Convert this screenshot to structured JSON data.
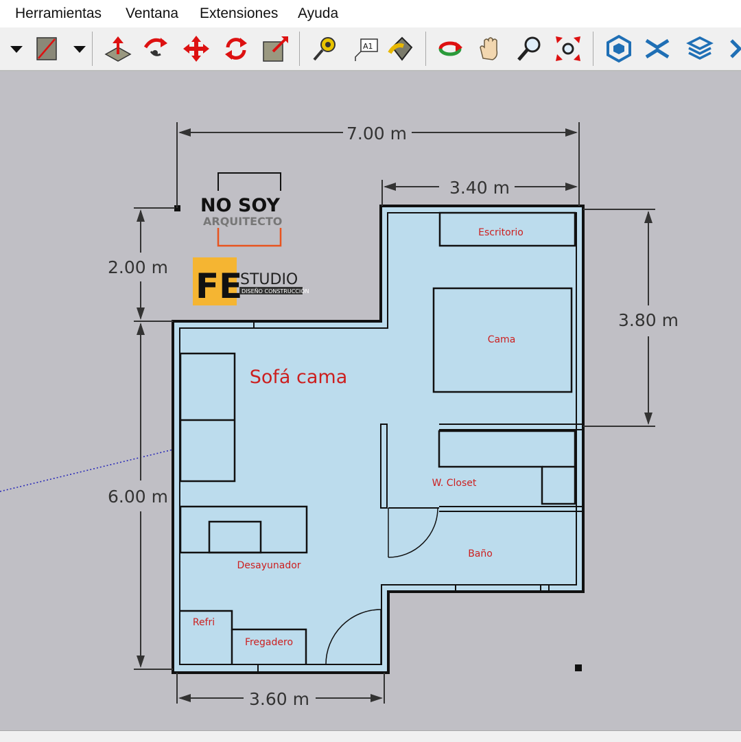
{
  "menu": {
    "items": [
      "Herramientas",
      "Ventana",
      "Extensiones",
      "Ayuda"
    ]
  },
  "toolbar": {
    "tools": [
      "dropdown-arrow-icon",
      "line-tool-icon",
      "dropdown-arrow-icon",
      "push-pull-icon",
      "follow-me-icon",
      "move-icon",
      "rotate-icon",
      "scale-icon",
      "tape-measure-icon",
      "text-label-icon",
      "paint-bucket-icon",
      "orbit-icon",
      "pan-icon",
      "zoom-icon",
      "zoom-extents-icon",
      "warehouse-icon",
      "extension-warehouse-icon",
      "layers-icon"
    ]
  },
  "floorplan": {
    "dimensions": {
      "total_width": "7.00 m",
      "upper_width": "3.40 m",
      "upper_height": "3.80 m",
      "offset_height": "2.00 m",
      "lower_height": "6.00 m",
      "lower_width": "3.60 m"
    },
    "rooms": {
      "sofa": "Sofá cama",
      "desk": "Escritorio",
      "bed": "Cama",
      "closet": "W. Closet",
      "bath": "Baño",
      "breakfast": "Desayunador",
      "fridge": "Refri",
      "sink": "Fregadero"
    },
    "colors": {
      "floor": "#bcdced",
      "wall": "#111111",
      "label": "#cc1f1f",
      "dimension": "#333333",
      "axis": "#2a2ab8"
    }
  },
  "logos": {
    "nosoy_line1": "NO SOY",
    "nosoy_line2": "ARQUITECTO",
    "fe_mark": "FE",
    "fe_word": "STUDIO",
    "fe_tag": "DISEÑO CONSTRUCCIÓN"
  }
}
